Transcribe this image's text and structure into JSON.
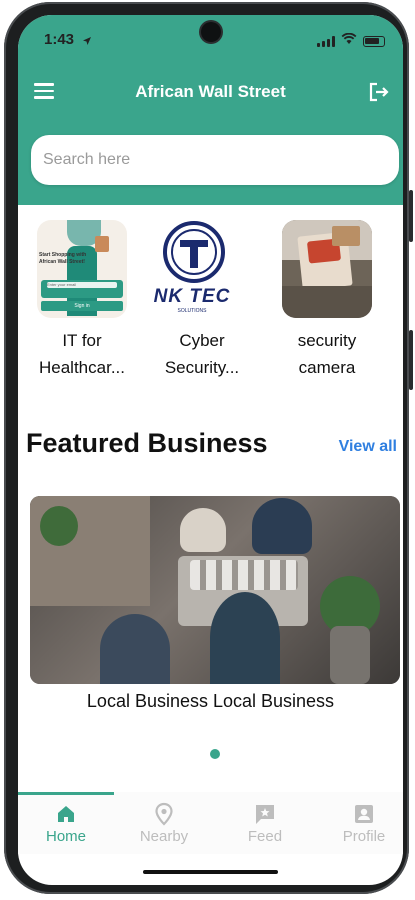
{
  "status_bar": {
    "time": "1:43"
  },
  "header": {
    "title": "African Wall Street"
  },
  "search": {
    "placeholder": "Search here"
  },
  "categories": [
    {
      "label": "IT for Healthcar...",
      "line1": "IT for",
      "line2": "Healthcar...",
      "thumb_text": {
        "line1": "Start Shopping with",
        "line2": "African Wall Street!",
        "field": "Enter your email",
        "button": "Sign in"
      }
    },
    {
      "label": "Cyber Security...",
      "line1": "Cyber",
      "line2": "Security...",
      "thumb_text": {
        "brand": "NK TEC",
        "sub": "SOLUTIONS"
      }
    },
    {
      "label": "security camera",
      "line1": "security",
      "line2": "camera"
    }
  ],
  "featured": {
    "title": "Featured Business",
    "view_all": "View all",
    "caption": "Local Business Local Business"
  },
  "carousel": {
    "pages": 1,
    "active_index": 0
  },
  "bottom_nav": [
    {
      "label": "Home",
      "icon": "home-icon",
      "active": true
    },
    {
      "label": "Nearby",
      "icon": "location-pin-icon",
      "active": false
    },
    {
      "label": "Feed",
      "icon": "feed-icon",
      "active": false
    },
    {
      "label": "Profile",
      "icon": "profile-icon",
      "active": false
    }
  ],
  "colors": {
    "accent": "#3aa58c",
    "link": "#2f7fe0",
    "inactive_nav": "#bdbdbd"
  }
}
